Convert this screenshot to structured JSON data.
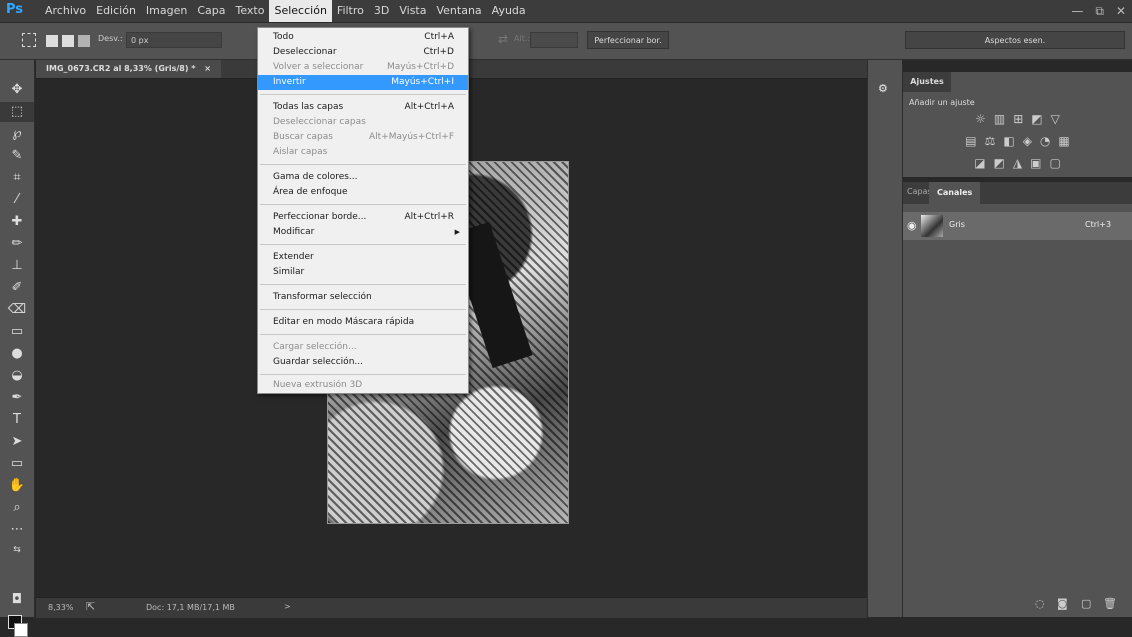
{
  "app": {
    "logo": "Ps",
    "menus": [
      "Archivo",
      "Edición",
      "Imagen",
      "Capa",
      "Texto",
      "Selección",
      "Filtro",
      "3D",
      "Vista",
      "Ventana",
      "Ayuda"
    ],
    "window_controls": [
      "—",
      "⧉",
      "✕"
    ]
  },
  "options_bar": {
    "feather_label": "Desv.:",
    "feather_value": "0 px",
    "height_label": "Alt.:",
    "refine_label": "Perfeccionar bor.",
    "workspace": "Aspectos esen."
  },
  "document": {
    "tab_title": "IMG_0673.CR2 al 8,33% (Gris/8) *",
    "tab_close": "×"
  },
  "status": {
    "zoom": "8,33%",
    "doc_size": "Doc: 17,1 MB/17,1 MB",
    "arrow": ">"
  },
  "panels": {
    "adjustments_tab": "Ajustes",
    "adjustments_title": "Añadir un ajuste",
    "adjust_icons_row1": [
      "☼",
      "▥",
      "⊞",
      "◩",
      "▽"
    ],
    "adjust_icons_row2": [
      "▤",
      "⚖",
      "◧",
      "◈",
      "◔",
      "▦"
    ],
    "adjust_icons_row3": [
      "◪",
      "◩",
      "◮",
      "▣",
      "▢"
    ],
    "tab_layers": "Capas",
    "tab_channels": "Canales",
    "channel_name": "Gris",
    "channel_shortcut": "Ctrl+3",
    "eye_icon": "👁"
  },
  "selection_menu": {
    "items": [
      {
        "label": "Todo",
        "shortcut": "Ctrl+A"
      },
      {
        "label": "Deseleccionar",
        "shortcut": "Ctrl+D"
      },
      {
        "label": "Volver a seleccionar",
        "shortcut": "Mayús+Ctrl+D"
      },
      {
        "label": "Invertir",
        "shortcut": "Mayús+Ctrl+I"
      },
      {
        "label": "Todas las capas",
        "shortcut": "Alt+Ctrl+A"
      },
      {
        "label": "Deseleccionar capas",
        "shortcut": ""
      },
      {
        "label": "Buscar capas",
        "shortcut": "Alt+Mayús+Ctrl+F"
      },
      {
        "label": "Aislar capas",
        "shortcut": ""
      },
      {
        "label": "Gama de colores...",
        "shortcut": ""
      },
      {
        "label": "Área de enfoque",
        "shortcut": ""
      },
      {
        "label": "Perfeccionar borde...",
        "shortcut": "Alt+Ctrl+R"
      },
      {
        "label": "Modificar",
        "shortcut": ""
      },
      {
        "label": "Extender",
        "shortcut": ""
      },
      {
        "label": "Similar",
        "shortcut": ""
      },
      {
        "label": "Transformar selección",
        "shortcut": ""
      },
      {
        "label": "Editar en modo Máscara rápida",
        "shortcut": ""
      },
      {
        "label": "Cargar selección...",
        "shortcut": ""
      },
      {
        "label": "Guardar selección...",
        "shortcut": ""
      },
      {
        "label": "Nueva extrusión 3D",
        "shortcut": ""
      }
    ]
  },
  "colors": {
    "highlight": "#3399ff",
    "ps_brand": "#31a8ff"
  }
}
